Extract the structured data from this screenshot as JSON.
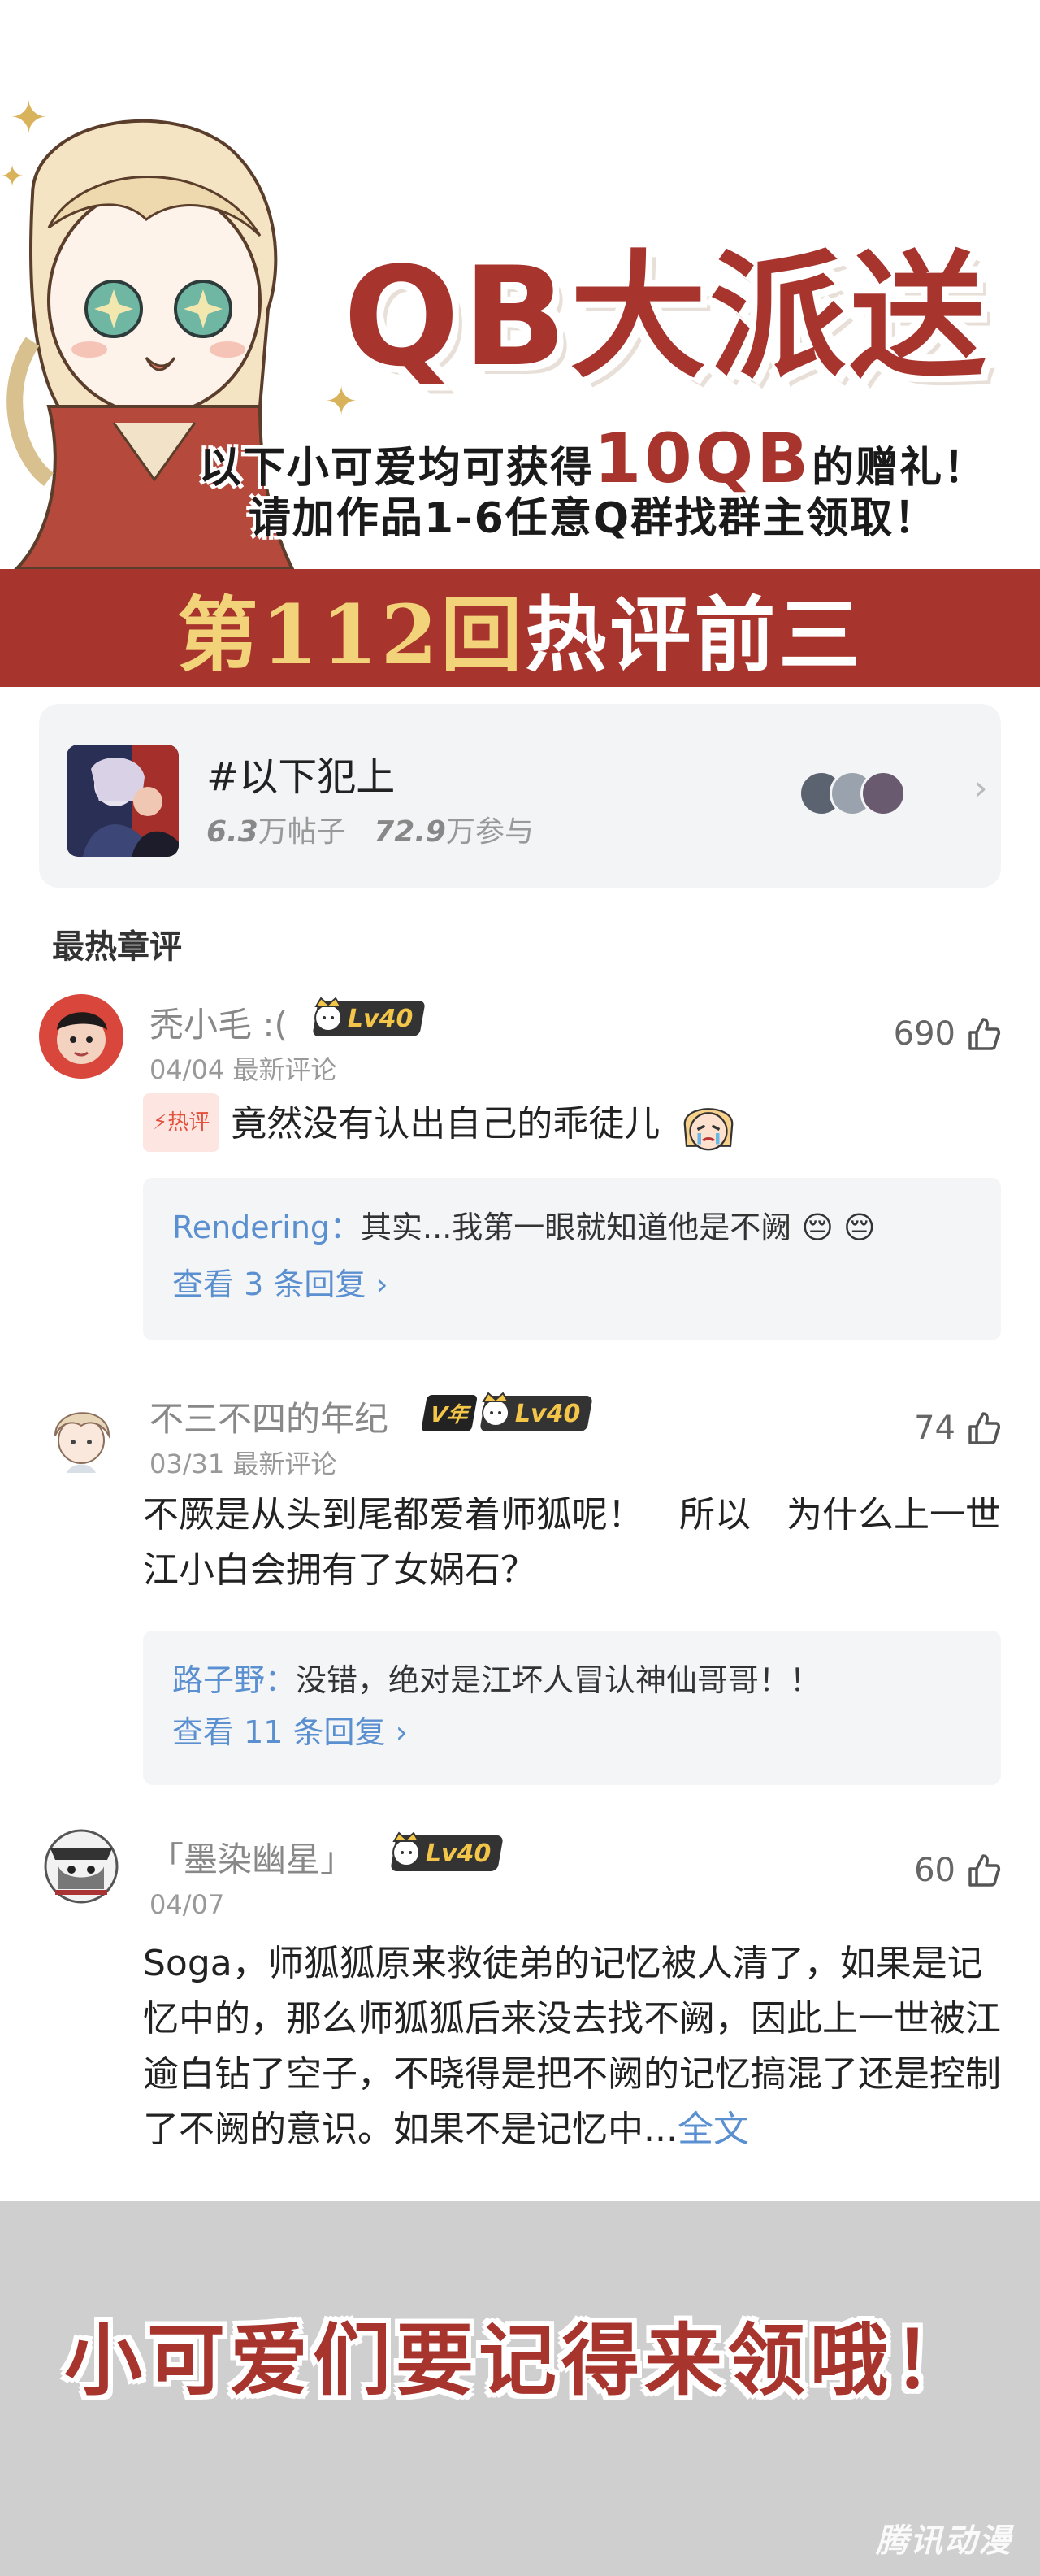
{
  "banner": {
    "title": "QB大派送",
    "line1_prefix": "以下小可爱均可获得",
    "line1_highlight": "10QB",
    "line1_suffix": "的赠礼！",
    "line2": "请加作品1-6任意Q群找群主领取！",
    "round_gold": "第112回",
    "round_white": "热评前三"
  },
  "topic": {
    "name": "#以下犯上",
    "posts_num": "6.3",
    "posts_unit": "万帖子",
    "join_num": "72.9",
    "join_unit": "万参与",
    "chevron": "›"
  },
  "section_title": "最热章评",
  "comments": [
    {
      "user": "秃小毛 :(",
      "level": "Lv40",
      "date": "04/04",
      "date_note": "最新评论",
      "likes": "690",
      "hot_tag": "⚡热评",
      "text": "竟然没有认出自己的乖徒儿",
      "reply_user": "Rendering：",
      "reply_text": "其实...我第一眼就知道他是不阙 😔 😔",
      "view_more": "查看 3 条回复 ›"
    },
    {
      "user": "不三不四的年纪",
      "vip": "V年",
      "level": "Lv40",
      "date": "03/31",
      "date_note": "最新评论",
      "likes": "74",
      "text": "不厥是从头到尾都爱着师狐呢！　所以　为什么上一世江小白会拥有了女娲石？",
      "reply_user": "路子野：",
      "reply_text": "没错，绝对是江坏人冒认神仙哥哥！！",
      "view_more": "查看 11 条回复 ›"
    },
    {
      "user": "「墨染幽星」",
      "level": "Lv40",
      "date": "04/07",
      "likes": "60",
      "text": "Soga，师狐狐原来救徒弟的记忆被人清了，如果是记忆中的，那么师狐狐后来没去找不阙，因此上一世被江逾白钻了空子，不晓得是把不阙的记忆搞混了还是控制了不阙的意识。如果不是记忆中...",
      "expand": "全文"
    }
  ],
  "footer": {
    "text": "小可爱们要记得来领哦！",
    "watermark": "腾讯动漫"
  },
  "colors": {
    "brand_red": "#a8342e",
    "gold": "#f3d37a",
    "link_blue": "#5a8fd0"
  },
  "icons": [
    "sparkle-icon",
    "thumbs-up-icon",
    "chevron-right-icon",
    "crown-icon"
  ]
}
